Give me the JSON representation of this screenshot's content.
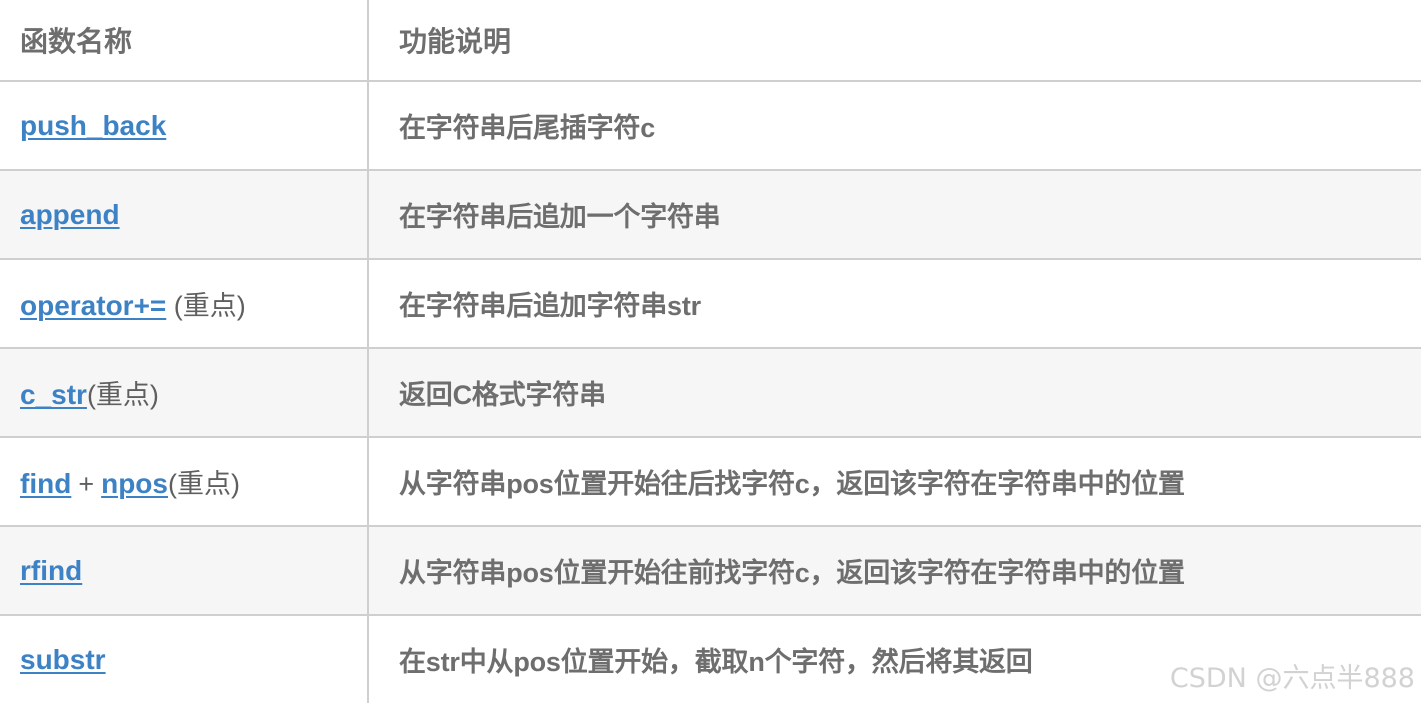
{
  "table": {
    "headers": {
      "name": "函数名称",
      "description": "功能说明"
    },
    "rows": [
      {
        "name_link": "push_back",
        "name_suffix": "",
        "name_link2": "",
        "name_join": "",
        "description": "在字符串后尾插字符c"
      },
      {
        "name_link": "append",
        "name_suffix": "",
        "name_link2": "",
        "name_join": "",
        "description": "在字符串后追加一个字符串"
      },
      {
        "name_link": "operator+=",
        "name_suffix": " (重点)",
        "name_link2": "",
        "name_join": "",
        "description": "在字符串后追加字符串str"
      },
      {
        "name_link": "c_str",
        "name_suffix": "(重点)",
        "name_link2": "",
        "name_join": "",
        "description": "返回C格式字符串"
      },
      {
        "name_link": "find",
        "name_join": "+",
        "name_link2": "npos",
        "name_suffix": "(重点)",
        "description": "从字符串pos位置开始往后找字符c，返回该字符在字符串中的位置"
      },
      {
        "name_link": "rfind",
        "name_suffix": "",
        "name_link2": "",
        "name_join": "",
        "description": "从字符串pos位置开始往前找字符c，返回该字符在字符串中的位置"
      },
      {
        "name_link": "substr",
        "name_suffix": "",
        "name_link2": "",
        "name_join": "",
        "description": "在str中从pos位置开始，截取n个字符，然后将其返回"
      }
    ]
  },
  "watermark": {
    "text": "CSDN @六点半888"
  },
  "colors": {
    "link": "#3d82c4",
    "text": "#6e6e6e",
    "border": "#cfcfcf",
    "row_alt_bg": "#f6f6f6",
    "watermark": "#d2d2d2"
  }
}
